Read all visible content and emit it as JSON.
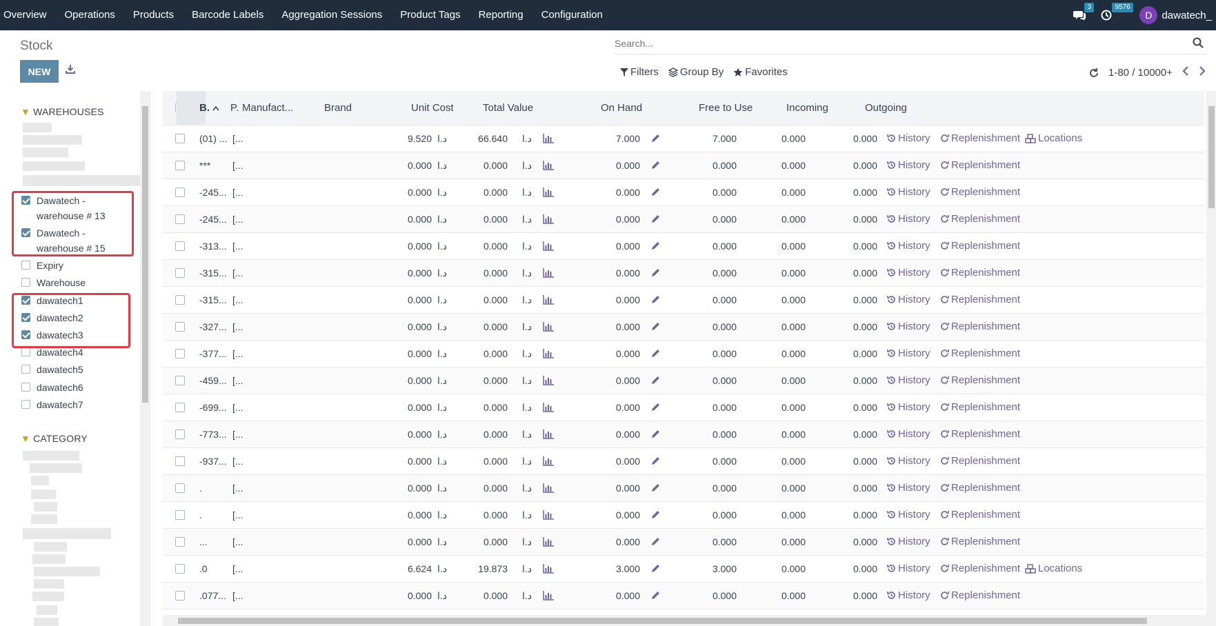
{
  "nav": {
    "menu": [
      "Overview",
      "Operations",
      "Products",
      "Barcode Labels",
      "Aggregation Sessions",
      "Product Tags",
      "Reporting",
      "Configuration"
    ],
    "messages_badge": "3",
    "activities_badge": "9576",
    "avatar_letter": "D",
    "user_name": "dawatech_"
  },
  "control_panel": {
    "title": "Stock",
    "new_label": "NEW",
    "search_placeholder": "Search...",
    "filters_label": "Filters",
    "groupby_label": "Group By",
    "favorites_label": "Favorites",
    "pager_value": "1-80 / 10000+"
  },
  "sidebar": {
    "warehouses_heading": "WAREHOUSES",
    "category_heading": "CATEGORY",
    "warehouses": [
      {
        "label": "Dawatech - warehouse # 13",
        "checked": true
      },
      {
        "label": "Dawatech - warehouse # 15",
        "checked": true
      },
      {
        "label": "Expiry",
        "checked": false
      },
      {
        "label": "Warehouse",
        "checked": false
      },
      {
        "label": "dawatech1",
        "checked": true
      },
      {
        "label": "dawatech2",
        "checked": true
      },
      {
        "label": "dawatech3",
        "checked": true
      },
      {
        "label": "dawatech4",
        "checked": false
      },
      {
        "label": "dawatech5",
        "checked": false
      },
      {
        "label": "dawatech6",
        "checked": false
      },
      {
        "label": "dawatech7",
        "checked": false
      }
    ]
  },
  "table": {
    "columns": [
      "B.",
      "P.",
      "Manufact...",
      "Brand",
      "Unit Cost",
      "Total Value",
      "On Hand",
      "Free to Use",
      "Incoming",
      "Outgoing"
    ],
    "currency": "د.ا",
    "history_label": "History",
    "replenishment_label": "Replenishment",
    "locations_label": "Locations",
    "rows": [
      {
        "b": "(01) ...",
        "p": "[...",
        "unit_cost": "9.520",
        "total_value": "66.640",
        "on_hand": "7.000",
        "free": "7.000",
        "incoming": "0.000",
        "outgoing": "0.000",
        "locations": true
      },
      {
        "b": "***",
        "p": "[...",
        "unit_cost": "0.000",
        "total_value": "0.000",
        "on_hand": "0.000",
        "free": "0.000",
        "incoming": "0.000",
        "outgoing": "0.000",
        "locations": false
      },
      {
        "b": "-245...",
        "p": "[...",
        "unit_cost": "0.000",
        "total_value": "0.000",
        "on_hand": "0.000",
        "free": "0.000",
        "incoming": "0.000",
        "outgoing": "0.000",
        "locations": false
      },
      {
        "b": "-245...",
        "p": "[...",
        "unit_cost": "0.000",
        "total_value": "0.000",
        "on_hand": "0.000",
        "free": "0.000",
        "incoming": "0.000",
        "outgoing": "0.000",
        "locations": false
      },
      {
        "b": "-313...",
        "p": "[...",
        "unit_cost": "0.000",
        "total_value": "0.000",
        "on_hand": "0.000",
        "free": "0.000",
        "incoming": "0.000",
        "outgoing": "0.000",
        "locations": false
      },
      {
        "b": "-315...",
        "p": "[...",
        "unit_cost": "0.000",
        "total_value": "0.000",
        "on_hand": "0.000",
        "free": "0.000",
        "incoming": "0.000",
        "outgoing": "0.000",
        "locations": false
      },
      {
        "b": "-315...",
        "p": "[...",
        "unit_cost": "0.000",
        "total_value": "0.000",
        "on_hand": "0.000",
        "free": "0.000",
        "incoming": "0.000",
        "outgoing": "0.000",
        "locations": false
      },
      {
        "b": "-327...",
        "p": "[...",
        "unit_cost": "0.000",
        "total_value": "0.000",
        "on_hand": "0.000",
        "free": "0.000",
        "incoming": "0.000",
        "outgoing": "0.000",
        "locations": false
      },
      {
        "b": "-377...",
        "p": "[...",
        "unit_cost": "0.000",
        "total_value": "0.000",
        "on_hand": "0.000",
        "free": "0.000",
        "incoming": "0.000",
        "outgoing": "0.000",
        "locations": false
      },
      {
        "b": "-459...",
        "p": "[...",
        "unit_cost": "0.000",
        "total_value": "0.000",
        "on_hand": "0.000",
        "free": "0.000",
        "incoming": "0.000",
        "outgoing": "0.000",
        "locations": false
      },
      {
        "b": "-699...",
        "p": "[...",
        "unit_cost": "0.000",
        "total_value": "0.000",
        "on_hand": "0.000",
        "free": "0.000",
        "incoming": "0.000",
        "outgoing": "0.000",
        "locations": false
      },
      {
        "b": "-773...",
        "p": "[...",
        "unit_cost": "0.000",
        "total_value": "0.000",
        "on_hand": "0.000",
        "free": "0.000",
        "incoming": "0.000",
        "outgoing": "0.000",
        "locations": false
      },
      {
        "b": "-937...",
        "p": "[...",
        "unit_cost": "0.000",
        "total_value": "0.000",
        "on_hand": "0.000",
        "free": "0.000",
        "incoming": "0.000",
        "outgoing": "0.000",
        "locations": false
      },
      {
        "b": ".",
        "p": "[...",
        "unit_cost": "0.000",
        "total_value": "0.000",
        "on_hand": "0.000",
        "free": "0.000",
        "incoming": "0.000",
        "outgoing": "0.000",
        "locations": false
      },
      {
        "b": ".",
        "p": "[...",
        "unit_cost": "0.000",
        "total_value": "0.000",
        "on_hand": "0.000",
        "free": "0.000",
        "incoming": "0.000",
        "outgoing": "0.000",
        "locations": false
      },
      {
        "b": "...",
        "p": "[...",
        "unit_cost": "0.000",
        "total_value": "0.000",
        "on_hand": "0.000",
        "free": "0.000",
        "incoming": "0.000",
        "outgoing": "0.000",
        "locations": false
      },
      {
        "b": ".0",
        "p": "[...",
        "unit_cost": "6.624",
        "total_value": "19.873",
        "on_hand": "3.000",
        "free": "3.000",
        "incoming": "0.000",
        "outgoing": "0.000",
        "locations": true
      },
      {
        "b": ".077...",
        "p": "[...",
        "unit_cost": "0.000",
        "total_value": "0.000",
        "on_hand": "0.000",
        "free": "0.000",
        "incoming": "0.000",
        "outgoing": "0.000",
        "locations": false
      }
    ]
  },
  "colors": {
    "nav_bg": "#1f2d3d",
    "primary": "#5c8aa6",
    "link": "#71639e",
    "highlight": "#e53945",
    "filter_icon": "#d4a017"
  }
}
